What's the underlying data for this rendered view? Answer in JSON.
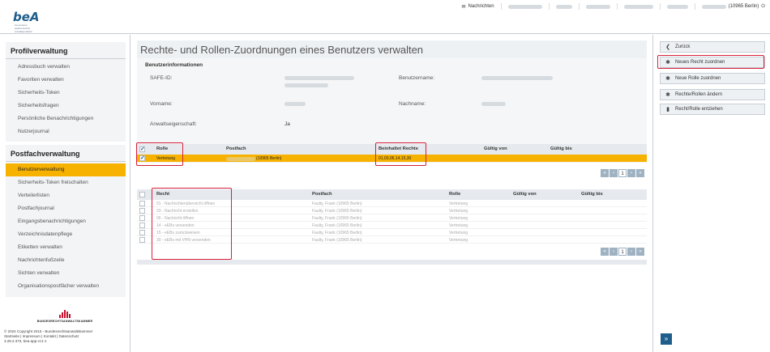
{
  "app": {
    "logo": "beA",
    "logo_tagline": "besonderes elektronisches Anwaltspostfach"
  },
  "topnav": {
    "messages_label": "Nachrichten",
    "account_suffix": "(10965 Berlin)"
  },
  "sidebar": {
    "profil": {
      "title": "Profilverwaltung",
      "items": [
        "Adressbuch verwalten",
        "Favoriten verwalten",
        "Sicherheits-Token",
        "Sicherheitsfragen",
        "Persönliche Benachrichtigungen",
        "Nutzerjournal"
      ]
    },
    "postfach": {
      "title": "Postfachverwaltung",
      "items": [
        "Benutzerverwaltung",
        "Sicherheits-Token freischalten",
        "Verteilerlisten",
        "Postfachjournal",
        "Eingangsbenachrichtigungen",
        "Verzeichnisdatenpflege",
        "Etiketten verwalten",
        "Nachrichtenfußzeile",
        "Sichten verwalten",
        "Organisationspostfächer verwalten"
      ],
      "active_index": 0
    },
    "brak_logo": "BUNDESRECHTSANWALTSKAMMER",
    "footer": {
      "copyright": "© 2024 Copyright 2015 - Bundesrechtsanwaltskammer",
      "links": "Startseite | Impressum | Kontakt | Datenschutz",
      "version": "3.28.2.373, bea-app-cc1-1"
    }
  },
  "page": {
    "title": "Rechte- und Rollen-Zuordnungen eines Benutzers verwalten",
    "user_info": {
      "heading": "Benutzerinformationen",
      "safe_id_label": "SAFE-ID:",
      "username_label": "Benutzername:",
      "firstname_label": "Vorname:",
      "lastname_label": "Nachname:",
      "lawyer_label": "Anwaltseigenschaft:",
      "lawyer_value": "Ja"
    },
    "roles_table": {
      "headers": [
        "Rolle",
        "Postfach",
        "Beinhaltet Rechte",
        "Gültig von",
        "Gültig bis"
      ],
      "rows": [
        {
          "role": "Vertretung",
          "postfach_suffix": "(10965 Berlin)",
          "rights": "01,03,06,14,15,30"
        }
      ],
      "pager": {
        "first": "«",
        "prev": "‹",
        "page": "1",
        "next": "›",
        "last": "»"
      }
    },
    "rights_table": {
      "headers": [
        "Recht",
        "Postfach",
        "Rolle",
        "Gültig von",
        "Gültig bis"
      ],
      "rows": [
        {
          "recht": "01 - Nachrichtenübersicht öffnen",
          "postfach": "Faulty, Frank (10965 Berlin)",
          "rolle": "Vertretung"
        },
        {
          "recht": "03 - Nachricht erstellen",
          "postfach": "Faulty, Frank (10965 Berlin)",
          "rolle": "Vertretung"
        },
        {
          "recht": "06 - Nachricht öffnen",
          "postfach": "Faulty, Frank (10965 Berlin)",
          "rolle": "Vertretung"
        },
        {
          "recht": "14 - eEBs versenden",
          "postfach": "Faulty, Frank (10965 Berlin)",
          "rolle": "Vertretung"
        },
        {
          "recht": "15 - eEBs zurückweisen",
          "postfach": "Faulty, Frank (10965 Berlin)",
          "rolle": "Vertretung"
        },
        {
          "recht": "30 - eEBs mit VHN versenden",
          "postfach": "Faulty, Frank (10965 Berlin)",
          "rolle": "Vertretung"
        }
      ],
      "pager": {
        "first": "«",
        "prev": "‹",
        "page": "1",
        "next": "›",
        "last": "»"
      }
    }
  },
  "actions": [
    {
      "label": "Zurück",
      "icon": "back-circle-icon",
      "glyph": "❮"
    },
    {
      "label": "Neues Recht zuordnen",
      "icon": "gear-icon",
      "glyph": "✱"
    },
    {
      "label": "Neue Rolle zuordnen",
      "icon": "gear-icon",
      "glyph": "✱"
    },
    {
      "label": "Rechte/Rollen ändern",
      "icon": "gear-icon",
      "glyph": "✱"
    },
    {
      "label": "Recht/Rolle entziehen",
      "icon": "trash-icon",
      "glyph": "▮"
    }
  ],
  "expand_button": "»",
  "colors": {
    "accent": "#f7b200",
    "brand": "#1f5e8b",
    "highlight": "#d6203a"
  }
}
